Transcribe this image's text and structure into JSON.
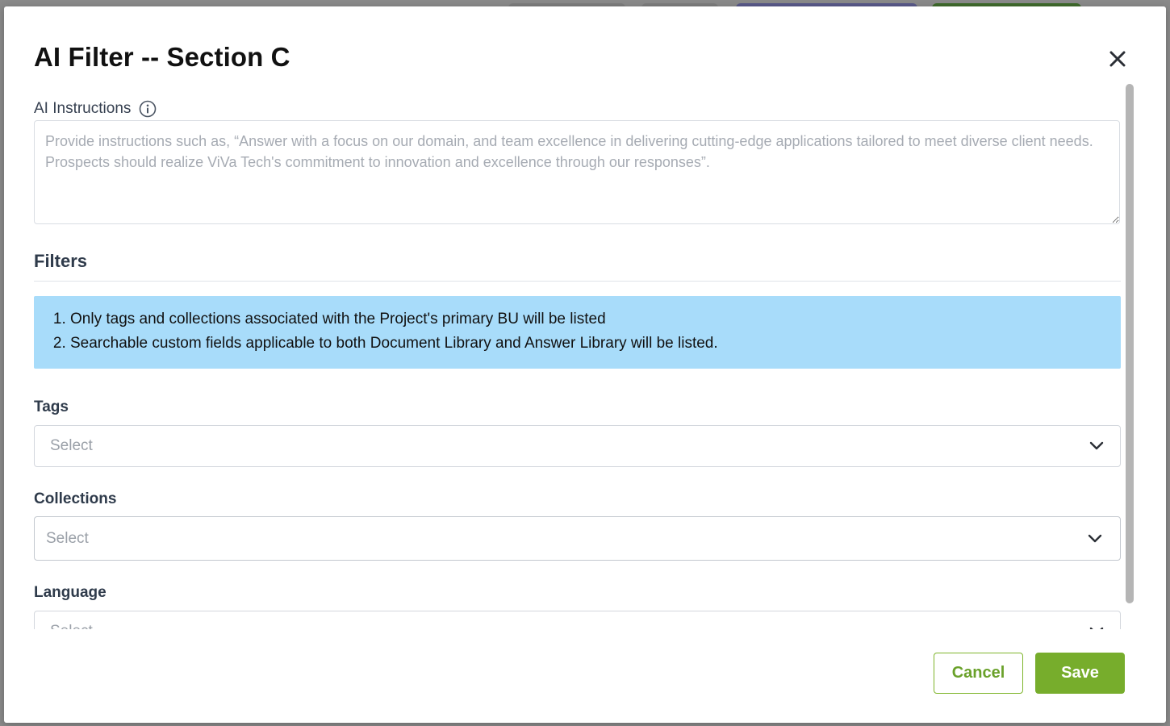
{
  "modal": {
    "title": "AI Filter -- Section C",
    "close_icon": "close-icon"
  },
  "ai_instructions": {
    "label": "AI Instructions",
    "info_icon": "info-icon",
    "placeholder": "Provide instructions such as, “Answer with a focus on our domain, and team excellence in delivering cutting-edge applications tailored to meet diverse client needs. Prospects should realize ViVa Tech's commitment to innovation and excellence through our responses”.",
    "value": ""
  },
  "filters": {
    "heading": "Filters",
    "notes": [
      "Only tags and collections associated with the Project's primary BU will be listed",
      "Searchable custom fields applicable to both Document Library and Answer Library will be listed."
    ],
    "fields": {
      "tags": {
        "label": "Tags",
        "placeholder": "Select"
      },
      "collections": {
        "label": "Collections",
        "placeholder": "Select"
      },
      "language": {
        "label": "Language",
        "placeholder": "Select"
      }
    }
  },
  "footer": {
    "cancel_label": "Cancel",
    "save_label": "Save"
  },
  "colors": {
    "accent": "#77ad2c",
    "info_box": "#a8dcfa"
  }
}
